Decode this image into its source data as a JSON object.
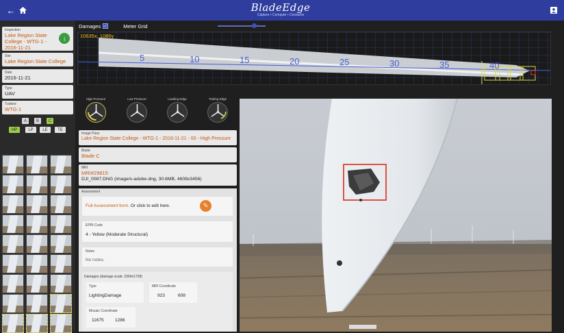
{
  "topbar": {
    "back_icon": "arrow-left-icon",
    "home_icon": "home-icon",
    "profile_icon": "account-icon"
  },
  "logo": {
    "name": "BladeEdge",
    "tagline": "Capture • Compute • Consume"
  },
  "sidebar": {
    "inspection": {
      "label": "Inspection",
      "value": "Lake Region State College - WTG-1 - 2016-11-21"
    },
    "site": {
      "label": "Site",
      "value": "Lake Region State College"
    },
    "date": {
      "label": "Date",
      "value": "2016-11-21"
    },
    "type": {
      "label": "Type",
      "value": "UAV"
    },
    "turbine": {
      "label": "Turbine",
      "value": "WTG-1"
    },
    "blade_chips": [
      "A",
      "B",
      "C"
    ],
    "side_chips": [
      "HP",
      "LP",
      "LE",
      "TE"
    ],
    "selected_blade": "C",
    "selected_side": "HP"
  },
  "header": {
    "damages_label": "Damages",
    "damages_checked": true,
    "meter_grid_label": "Meter Grid",
    "meter_grid_level": 0.72
  },
  "mosaic": {
    "coordinate": "10635x, 1086y",
    "scale_labels": [
      "5",
      "10",
      "15",
      "20",
      "25",
      "30",
      "35",
      "40"
    ]
  },
  "gauges": [
    "High Pressure",
    "Low Pressure",
    "Leading Edge",
    "Trailing Edge"
  ],
  "details": {
    "image_pass": {
      "label": "Image Pass",
      "value": "Lake Region State College - WTG-1 - 2016-11-21 - 00 - High Pressure"
    },
    "blade": {
      "label": "Blade",
      "value": "Blade C"
    },
    "mri": {
      "label": "MRI",
      "value": "MRI#29815",
      "file": "DJI_0087.DNG (image/x-adobe-dng, 30.6MB, 4608x3456)"
    }
  },
  "assessment": {
    "label": "Assessment",
    "form_text_link": "Full Assessment form.",
    "form_text_rest": " Or click to edit here.",
    "epri_label": "EPRI Code",
    "epri_value": "4 - Yellow (Moderate Structural)",
    "notes_label": "Notes",
    "notes_value": "No notes.",
    "damages_label": "Damages (damage scale: 2304x1728)",
    "type_label": "Type",
    "type_value": "LightingDamage",
    "mri_coord_label": "MRI Coordinate",
    "mri_coord_x": "923",
    "mri_coord_y": "608",
    "mosaic_coord_label": "Mosaic Coordinate",
    "mosaic_coord_x": "11675",
    "mosaic_coord_y": "1286"
  },
  "colors": {
    "topbar": "#2f3e9e",
    "accent_orange": "#c8570e",
    "download_green": "#3c9b3e",
    "edit_orange": "#e8802a",
    "damage_box": "#d9412e"
  }
}
